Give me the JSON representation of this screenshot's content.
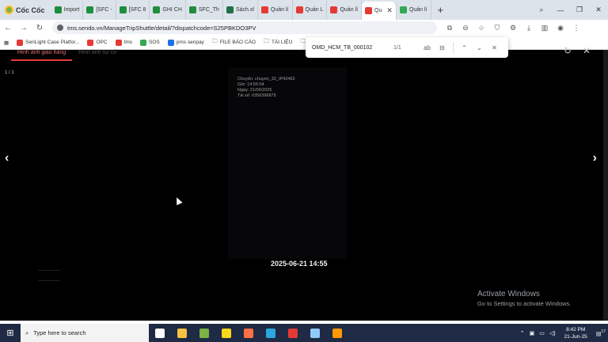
{
  "browser": {
    "brand": "Cốc Cốc",
    "tabs": [
      {
        "label": "Import",
        "color": "#1e8e3e"
      },
      {
        "label": "[SFC -",
        "color": "#1e8e3e"
      },
      {
        "label": "[SFC 8",
        "color": "#1e8e3e"
      },
      {
        "label": "GHI CH",
        "color": "#1e8e3e"
      },
      {
        "label": "SFC_Th",
        "color": "#1e8e3e"
      },
      {
        "label": "Sách.xl",
        "color": "#1e7145"
      },
      {
        "label": "Quản lí",
        "color": "#e53935"
      },
      {
        "label": "Quản L",
        "color": "#e53935"
      },
      {
        "label": "Quản lí",
        "color": "#e53935"
      },
      {
        "label": "Qu",
        "color": "#e53935",
        "active": true
      },
      {
        "label": "Quản lí",
        "color": "#34a853"
      }
    ],
    "url": "tms.sendo.vn/ManageTripShuttle/detail/?dispatchcode=S25PBKDO3PV",
    "bookmarks": [
      {
        "label": "SenLight Case Platfor...",
        "color": "#e53935"
      },
      {
        "label": "OPC",
        "color": "#e53935"
      },
      {
        "label": "tms",
        "color": "#e53935"
      },
      {
        "label": "SOS",
        "color": "#34a853"
      },
      {
        "label": "pms senpay",
        "color": "#1a73e8"
      },
      {
        "label": "FILE BÁO CÁO",
        "color": ""
      },
      {
        "label": "TÀI LIỆU",
        "color": ""
      },
      {
        "label": "FIL",
        "color": ""
      }
    ]
  },
  "find": {
    "query": "OMD_HCM_TB_000102",
    "count": "1/1",
    "case_label": "ab"
  },
  "viewer": {
    "tabs": [
      "Hình ảnh giao hàng",
      "Hình ảnh sự cố"
    ],
    "counter": "1 / 1",
    "overlay_lines": [
      "Chuyến: chuyen_32_IP42463",
      "Giờ: 14:55:04",
      "Ngày: 21/06/2025",
      "Tài xế: 0356396875"
    ],
    "timestamp": "2025-06-21 14:55",
    "prev_icon": "‹",
    "next_icon": "›"
  },
  "watermark": {
    "title": "Activate Windows",
    "subtitle": "Go to Settings to activate Windows."
  },
  "taskbar": {
    "search_placeholder": "Type here to search",
    "time": "8:42 PM",
    "date": "21-Jun-25",
    "notification_count": "17",
    "apps": [
      {
        "name": "task-view",
        "color": "#ffffff"
      },
      {
        "name": "file-explorer",
        "color": "#f6c343"
      },
      {
        "name": "coccoc",
        "color": "#7cb342"
      },
      {
        "name": "sticky-notes",
        "color": "#f9d71c"
      },
      {
        "name": "chrome-like",
        "color": "#ff7043"
      },
      {
        "name": "edge",
        "color": "#2ea7e0"
      },
      {
        "name": "app-red",
        "color": "#e53935"
      },
      {
        "name": "app-blue",
        "color": "#90caf9"
      },
      {
        "name": "app-orange",
        "color": "#ff9800"
      }
    ]
  }
}
